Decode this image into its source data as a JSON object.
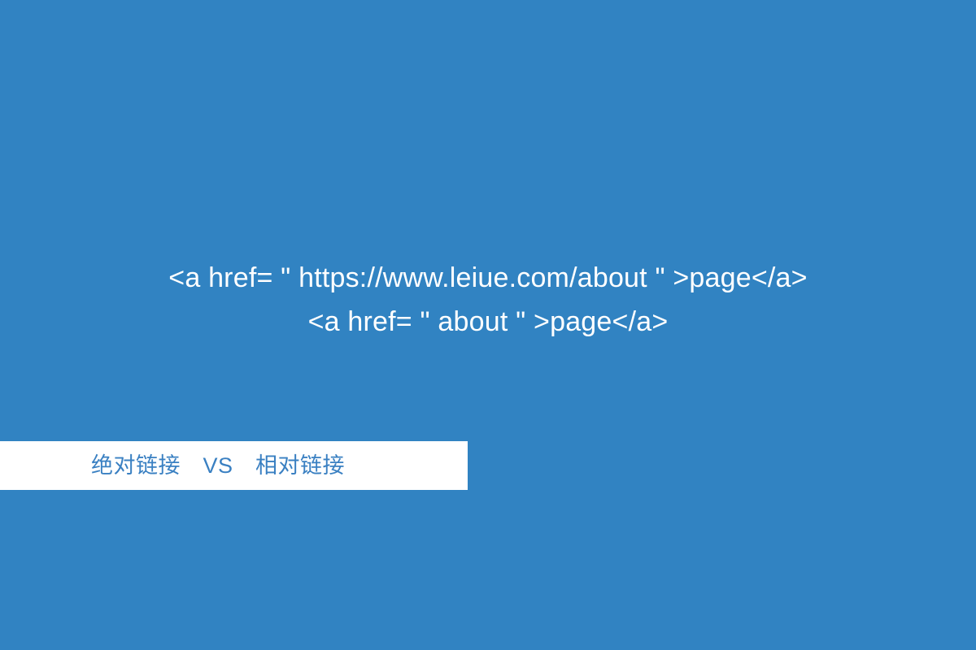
{
  "slide": {
    "background_color": "#3183c2",
    "code": {
      "text_color": "#ffffff",
      "lines": [
        "<a href= \" https://www.leiue.com/about \" >page</a>",
        "<a href= \" about \" >page</a>"
      ]
    },
    "banner": {
      "background_color": "#ffffff",
      "text_color": "#3a80c2",
      "caption": "绝对链接　VS　相对链接",
      "left_term": "绝对链接",
      "separator": "VS",
      "right_term": "相对链接"
    }
  }
}
